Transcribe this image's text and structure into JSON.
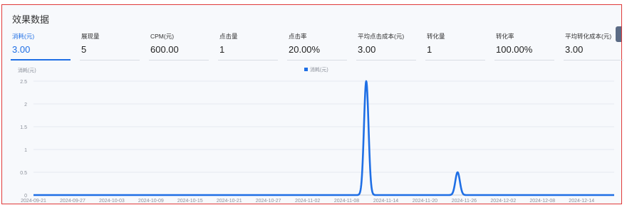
{
  "panel": {
    "title": "效果数据"
  },
  "metrics": [
    {
      "label": "消耗(元)",
      "value": "3.00"
    },
    {
      "label": "展现量",
      "value": "5"
    },
    {
      "label": "CPM(元)",
      "value": "600.00"
    },
    {
      "label": "点击量",
      "value": "1"
    },
    {
      "label": "点击率",
      "value": "20.00%"
    },
    {
      "label": "平均点击成本(元)",
      "value": "3.00"
    },
    {
      "label": "转化量",
      "value": "1"
    },
    {
      "label": "转化率",
      "value": "100.00%"
    },
    {
      "label": "平均转化成本(元)",
      "value": "3.00"
    }
  ],
  "colors": {
    "accent": "#1f6fe5",
    "line": "#1f6fe5",
    "grid": "#e6e9ef"
  },
  "chart_data": {
    "type": "line",
    "ylabel": "消耗(元)",
    "legend": {
      "label": "消耗(元)",
      "placement": "top-center"
    },
    "yticks": [
      "0",
      "0.5",
      "1",
      "1.5",
      "2",
      "2.5"
    ],
    "ylim": [
      0,
      2.5
    ],
    "xticks": [
      "2024-09-21",
      "2024-09-27",
      "2024-10-03",
      "2024-10-09",
      "2024-10-15",
      "2024-10-21",
      "2024-10-27",
      "2024-11-02",
      "2024-11-08",
      "2024-11-14",
      "2024-11-20",
      "2024-11-26",
      "2024-12-02",
      "2024-12-08",
      "2024-12-14"
    ],
    "x_range": [
      "2024-09-21",
      "2024-12-19"
    ],
    "series": [
      {
        "name": "消耗(元)",
        "points": [
          {
            "x": "2024-11-11",
            "y": 2.5
          },
          {
            "x": "2024-11-25",
            "y": 0.5
          }
        ],
        "default": 0
      }
    ]
  }
}
